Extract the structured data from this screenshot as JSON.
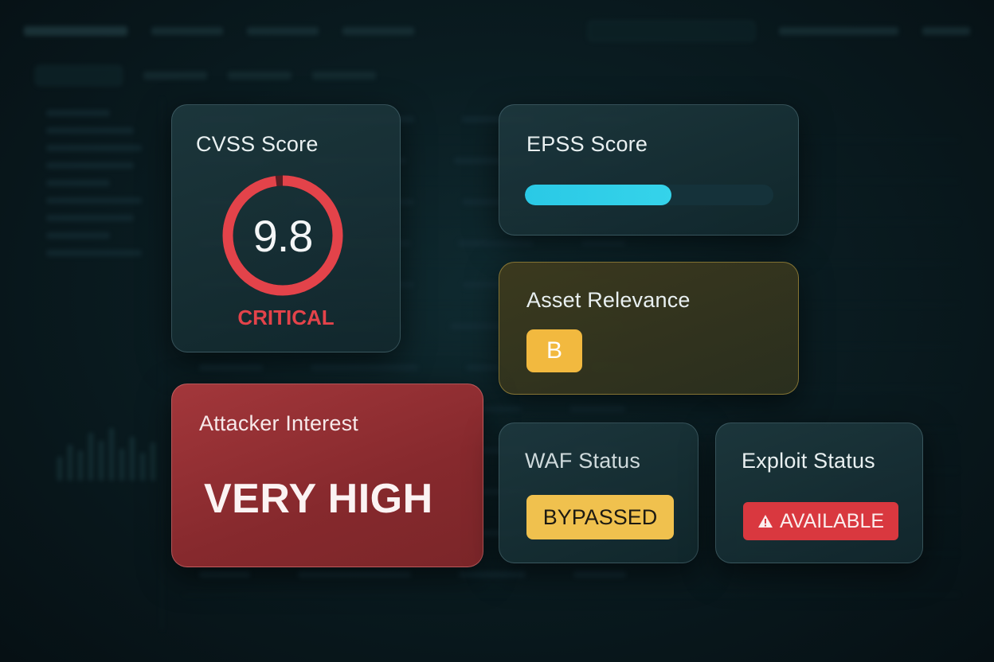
{
  "cards": {
    "cvss": {
      "title": "CVSS Score",
      "value": "9.8",
      "max": 10,
      "severity": "CRITICAL",
      "ring_color": "#e3434a"
    },
    "epss": {
      "title": "EPSS Score",
      "progress_fraction": 0.59,
      "bar_color": "#2ac9e6"
    },
    "asset_relevance": {
      "title": "Asset Relevance",
      "grade": "B",
      "badge_color": "#f2b93f"
    },
    "attacker_interest": {
      "title": "Attacker Interest",
      "value": "VERY HIGH",
      "card_color": "#a3373b"
    },
    "waf_status": {
      "title": "WAF Status",
      "value": "BYPASSED",
      "badge_color": "#f0c14e"
    },
    "exploit_status": {
      "title": "Exploit Status",
      "value": "AVAILABLE",
      "icon": "warning-icon",
      "badge_color": "#d9383f"
    }
  }
}
